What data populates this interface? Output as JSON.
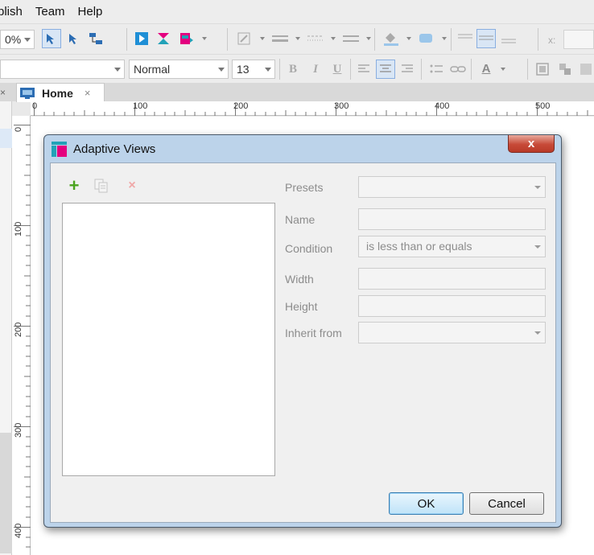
{
  "menubar": {
    "items": [
      "blish",
      "Team",
      "Help"
    ]
  },
  "toolbar": {
    "zoom_value": "0%",
    "style_value": "",
    "paragraph_style": "Normal",
    "font_size": "13",
    "bold_label": "B",
    "italic_label": "I",
    "underline_label": "U",
    "text_color_label": "A",
    "x_label": "x:"
  },
  "tabs": {
    "home_label": "Home",
    "close_glyph": "×",
    "panel_close_glyph": "×"
  },
  "ruler": {
    "h_labels": [
      "0",
      "100",
      "200",
      "300",
      "400",
      "500"
    ],
    "v_labels": [
      "0",
      "100",
      "200",
      "300",
      "400"
    ]
  },
  "dialog": {
    "title": "Adaptive Views",
    "close_glyph": "x",
    "add_glyph": "+",
    "delete_glyph": "×",
    "labels": {
      "presets": "Presets",
      "name": "Name",
      "condition": "Condition",
      "width": "Width",
      "height": "Height",
      "inherit": "Inherit from"
    },
    "values": {
      "presets": "",
      "name": "",
      "condition": "is less than or equals",
      "width": "",
      "height": "",
      "inherit": ""
    },
    "ok_label": "OK",
    "cancel_label": "Cancel"
  },
  "colors": {
    "accent_teal": "#22a2b8",
    "accent_pink": "#e4007f",
    "add_green": "#4aa31f",
    "close_red": "#c74a38"
  }
}
